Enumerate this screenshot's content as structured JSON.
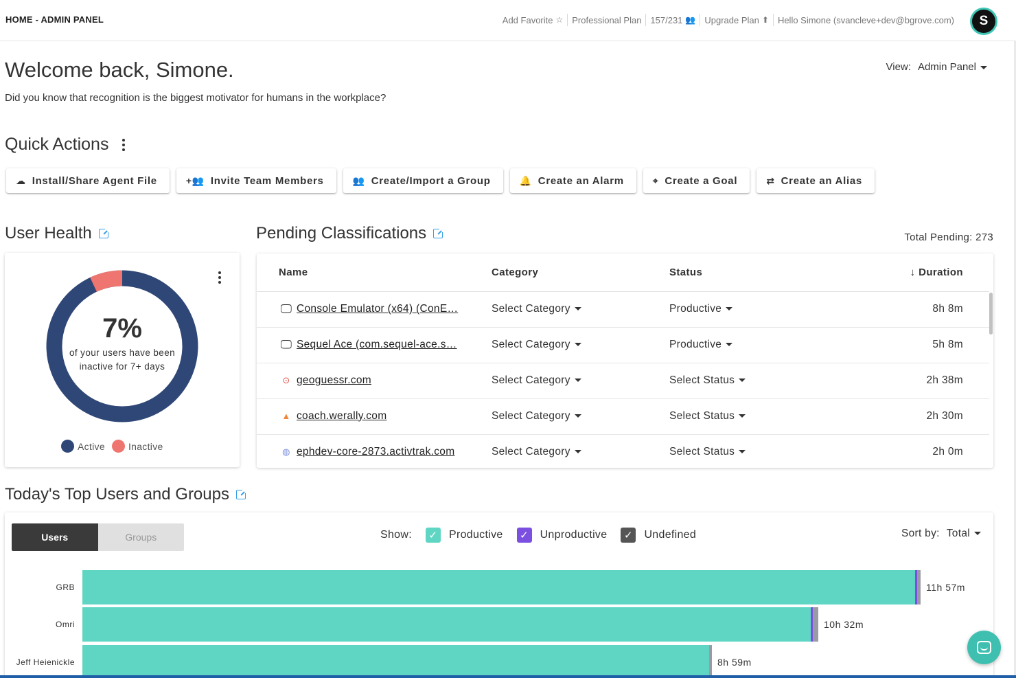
{
  "header": {
    "breadcrumb": "HOME - ADMIN PANEL",
    "add_favorite": "Add Favorite",
    "plan": "Professional Plan",
    "seats": "157/231",
    "upgrade": "Upgrade Plan",
    "greeting": "Hello Simone (svancleve+dev@bgrove.com)",
    "avatar_letter": "S"
  },
  "welcome": {
    "title": "Welcome back, Simone.",
    "tip": "Did you know that recognition is the biggest motivator for humans in the workplace?",
    "view_label": "View:",
    "view_value": "Admin Panel"
  },
  "quick_actions": {
    "title": "Quick Actions",
    "buttons": [
      {
        "label": "Install/Share Agent File",
        "icon": "cloud-upload-icon"
      },
      {
        "label": "Invite Team Members",
        "icon": "person-add-icon"
      },
      {
        "label": "Create/Import a Group",
        "icon": "group-icon"
      },
      {
        "label": "Create an Alarm",
        "icon": "alarm-bell-icon"
      },
      {
        "label": "Create a Goal",
        "icon": "target-icon"
      },
      {
        "label": "Create an Alias",
        "icon": "alias-icon"
      }
    ]
  },
  "user_health": {
    "title": "User Health",
    "inactive_pct": 7,
    "pct_label": "7%",
    "description": "of your users have been inactive for 7+ days",
    "legend_active": "Active",
    "legend_inactive": "Inactive",
    "colors": {
      "active": "#2f4776",
      "inactive": "#ef7670"
    }
  },
  "pending": {
    "title": "Pending Classifications",
    "total": "Total Pending: 273",
    "columns": {
      "name": "Name",
      "category": "Category",
      "status": "Status",
      "duration": "Duration"
    },
    "rows": [
      {
        "icon": "monitor-icon",
        "name": "Console Emulator (x64) (ConE…",
        "category": "Select Category",
        "status": "Productive",
        "duration": "8h 8m"
      },
      {
        "icon": "monitor-icon",
        "name": "Sequel Ace (com.sequel-ace.s…",
        "category": "Select Category",
        "status": "Productive",
        "duration": "5h 8m"
      },
      {
        "icon": "location-pin-icon",
        "name": "geoguessr.com",
        "category": "Select Category",
        "status": "Select Status",
        "duration": "2h 38m"
      },
      {
        "icon": "werally-logo-icon",
        "name": "coach.werally.com",
        "category": "Select Category",
        "status": "Select Status",
        "duration": "2h 30m"
      },
      {
        "icon": "globe-icon",
        "name": "ephdev-core-2873.activtrak.com",
        "category": "Select Category",
        "status": "Select Status",
        "duration": "2h 0m"
      }
    ]
  },
  "top_users": {
    "title": "Today's Top Users and Groups",
    "toggle": {
      "users": "Users",
      "groups": "Groups"
    },
    "show_label": "Show:",
    "filters": [
      {
        "label": "Productive",
        "color": "#5fd6c4",
        "checked": true
      },
      {
        "label": "Unproductive",
        "color": "#7b4fe0",
        "checked": true
      },
      {
        "label": "Undefined",
        "color": "#555555",
        "checked": true
      }
    ],
    "sort_label": "Sort by:",
    "sort_value": "Total",
    "rows": [
      {
        "name": "GRB",
        "total": "11h 57m",
        "productive_fraction": 0.91,
        "unproductive_fraction": 0.002,
        "undefined_fraction": 0.004
      },
      {
        "name": "Omri",
        "total": "10h 32m",
        "productive_fraction": 0.796,
        "unproductive_fraction": 0.002,
        "undefined_fraction": 0.006
      },
      {
        "name": "Jeff Heienickle",
        "total": "8h 59m",
        "productive_fraction": 0.685,
        "unproductive_fraction": 0.0,
        "undefined_fraction": 0.003
      }
    ]
  }
}
